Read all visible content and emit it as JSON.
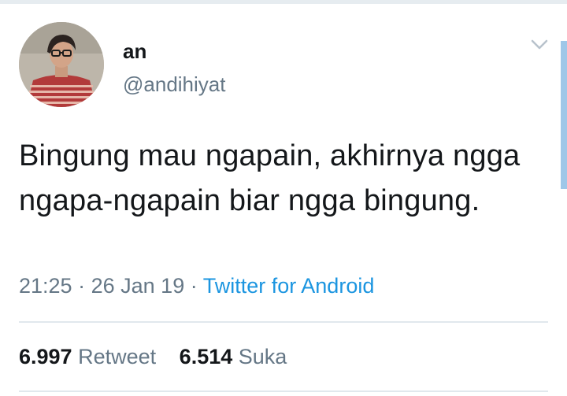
{
  "user": {
    "display_name": "an",
    "handle": "@andihiyat"
  },
  "tweet": {
    "text": "Bingung mau ngapain, akhirnya ngga ngapa-ngapain biar ngga bingung.",
    "time": "21:25",
    "date": "26 Jan 19",
    "separator": "·",
    "source": "Twitter for Android"
  },
  "stats": {
    "retweets_count": "6.997",
    "retweets_label": "Retweet",
    "likes_count": "6.514",
    "likes_label": "Suka"
  },
  "icons": {
    "avatar": "profile-photo",
    "menu": "chevron-down-icon"
  },
  "colors": {
    "text": "#14171a",
    "secondary": "#657786",
    "link": "#1b95e0",
    "divider": "#e1e8ed"
  }
}
